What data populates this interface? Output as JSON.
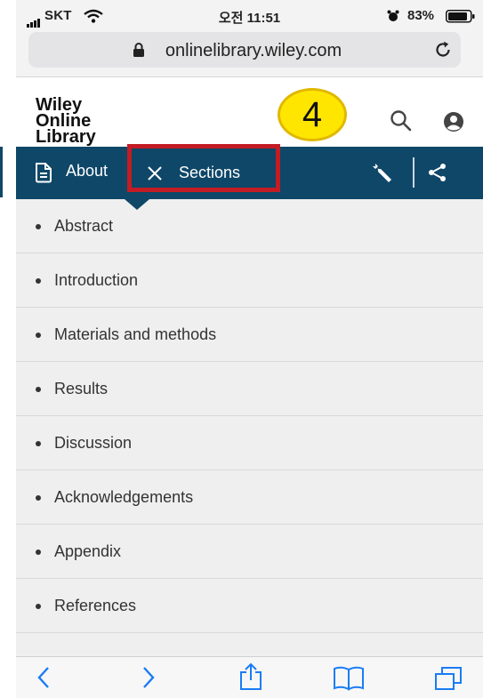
{
  "status_bar": {
    "carrier": "SKT",
    "time": "오전 11:51",
    "battery": "83%"
  },
  "browser": {
    "url": "onlinelibrary.wiley.com"
  },
  "header": {
    "logo_lines": [
      "Wiley",
      "Online",
      "Library"
    ],
    "step_number": "4"
  },
  "nav": {
    "about_label": "About",
    "sections_label": "Sections"
  },
  "sections": [
    {
      "label": "Abstract"
    },
    {
      "label": "Introduction"
    },
    {
      "label": "Materials and methods"
    },
    {
      "label": "Results"
    },
    {
      "label": "Discussion"
    },
    {
      "label": "Acknowledgements"
    },
    {
      "label": "Appendix"
    },
    {
      "label": "References"
    }
  ],
  "colors": {
    "nav_bg": "#0f4768",
    "highlight": "#c31c24",
    "badge": "#ffe600",
    "ios_blue": "#1a7cf5"
  },
  "toolbar_icons": [
    "back-icon",
    "forward-icon",
    "share-icon",
    "bookmarks-icon",
    "tabs-icon"
  ]
}
